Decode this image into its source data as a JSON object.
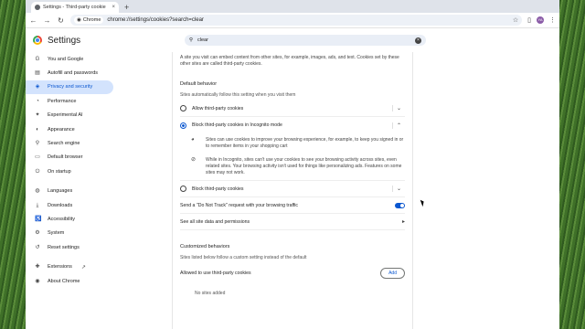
{
  "browser": {
    "tab_title": "Settings - Third-party cookie",
    "tab_close": "×",
    "new_tab": "+",
    "site_chip": "Chrome",
    "url": "chrome://settings/cookies?search=clear",
    "avatar_initials": "YA"
  },
  "header": {
    "title": "Settings",
    "search_value": "clear",
    "search_clear": "×"
  },
  "sidebar": {
    "items": [
      {
        "label": "You and Google",
        "icon": "google-icon"
      },
      {
        "label": "Autofill and passwords",
        "icon": "clipboard-icon"
      },
      {
        "label": "Privacy and security",
        "icon": "shield-icon",
        "active": true
      },
      {
        "label": "Performance",
        "icon": "speedometer-icon"
      },
      {
        "label": "Experimental AI",
        "icon": "sparkle-icon"
      },
      {
        "label": "Appearance",
        "icon": "palette-icon"
      },
      {
        "label": "Search engine",
        "icon": "search-icon"
      },
      {
        "label": "Default browser",
        "icon": "browser-icon"
      },
      {
        "label": "On startup",
        "icon": "power-icon"
      },
      {
        "label": "Languages",
        "icon": "globe-icon"
      },
      {
        "label": "Downloads",
        "icon": "download-icon"
      },
      {
        "label": "Accessibility",
        "icon": "accessibility-icon"
      },
      {
        "label": "System",
        "icon": "wrench-icon"
      },
      {
        "label": "Reset settings",
        "icon": "reset-icon"
      },
      {
        "label": "Extensions",
        "icon": "puzzle-icon"
      },
      {
        "label": "About Chrome",
        "icon": "chrome-icon"
      }
    ]
  },
  "content": {
    "intro": "A site you visit can embed content from other sites, for example, images, ads, and text. Cookies set by these other sites are called third-party cookies.",
    "default_behavior": {
      "heading": "Default behavior",
      "subheading": "Sites automatically follow this setting when you visit them",
      "options": [
        {
          "label": "Allow third-party cookies",
          "selected": false
        },
        {
          "label": "Block third-party cookies in Incognito mode",
          "selected": true
        },
        {
          "label": "Block third-party cookies",
          "selected": false
        }
      ],
      "details": [
        "Sites can use cookies to improve your browsing experience, for example, to keep you signed in or to remember items in your shopping cart",
        "While in Incognito, sites can't use your cookies to see your browsing activity across sites, even related sites. Your browsing activity isn't used for things like personalizing ads. Features on some sites may not work."
      ]
    },
    "dnt_label": "Send a \"Do Not Track\" request with your browsing traffic",
    "dnt_enabled": true,
    "see_all_label": "See all site data and permissions",
    "customized": {
      "heading": "Customized behaviors",
      "subheading": "Sites listed below follow a custom setting instead of the default",
      "allowed_label": "Allowed to use third-party cookies",
      "add_label": "Add",
      "empty_label": "No sites added"
    }
  },
  "colors": {
    "accent": "#0b57d0",
    "active_bg": "#d3e3fd"
  }
}
